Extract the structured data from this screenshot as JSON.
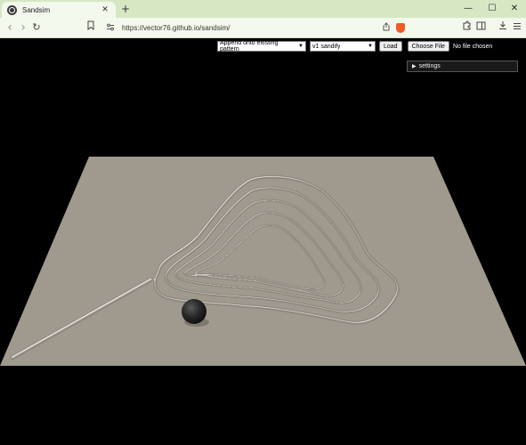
{
  "browser": {
    "tab_title": "Sandsim",
    "tab_close": "✕",
    "new_tab": "+",
    "url": "https://vector76.github.io/sandsim/",
    "window_controls": {
      "minimize": "—",
      "maximize": "☐",
      "close": "✕"
    },
    "nav": {
      "back": "‹",
      "forward": "›",
      "reload": "↻",
      "bookmark": "☐"
    },
    "icons": [
      "globe-icon",
      "bookmark-icon",
      "site-settings-icon",
      "share-icon",
      "brave-shield-icon",
      "extensions-icon",
      "sidebar-icon",
      "download-icon",
      "menu-icon"
    ]
  },
  "page": {
    "mode_select": {
      "value": "Append onto existing pattern"
    },
    "pattern_select": {
      "value": "v1 sandify"
    },
    "load_button": "Load",
    "file_button": "Choose File",
    "file_status": "No file chosen",
    "settings_label": "settings",
    "sand_color": "#a09a8e",
    "ball_color": "#1b1b1b"
  }
}
